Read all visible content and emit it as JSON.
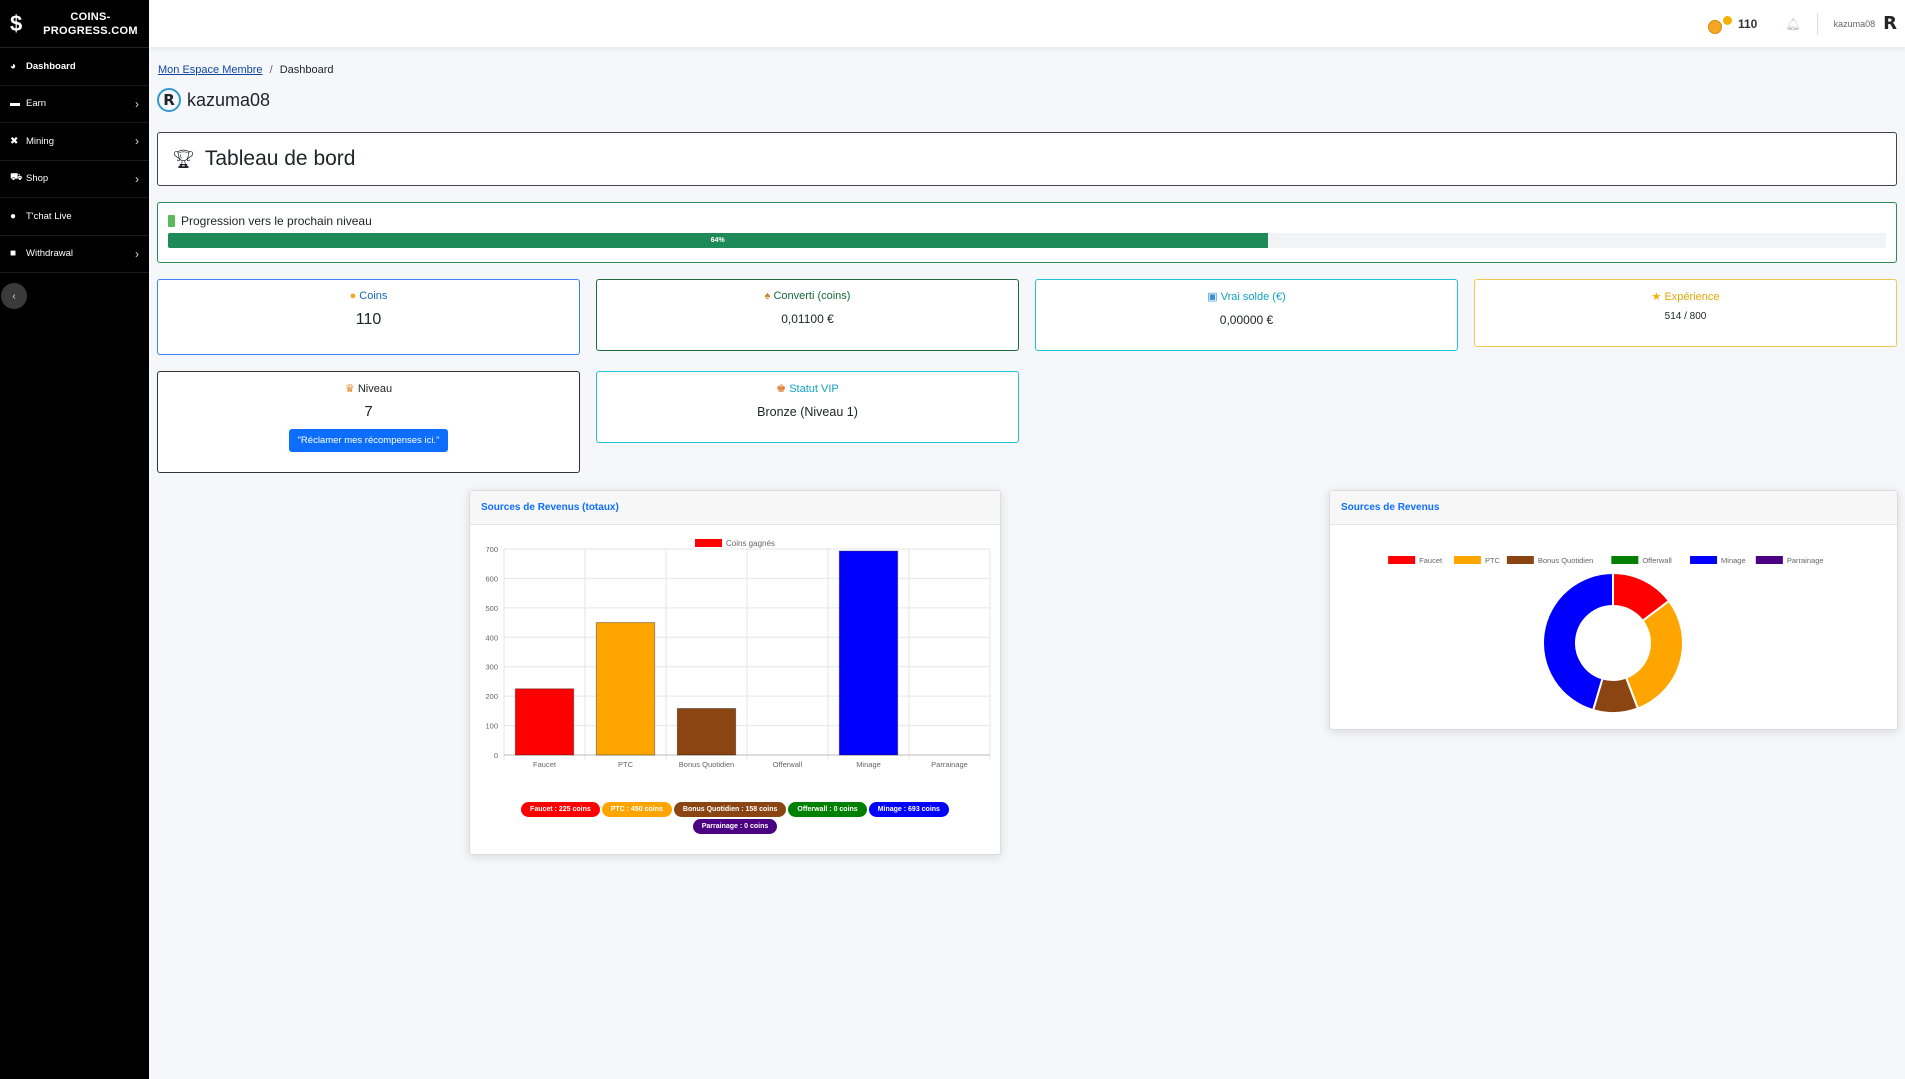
{
  "sidebar": {
    "brand_symbol": "$",
    "brand_line1": "COINS-",
    "brand_line2": "PROGRESS.COM",
    "items": [
      {
        "label": "Dashboard",
        "icon": "dashboard-icon",
        "has_submenu": false
      },
      {
        "label": "Earn",
        "icon": "money-icon",
        "has_submenu": true
      },
      {
        "label": "Mining",
        "icon": "tools-icon",
        "has_submenu": true
      },
      {
        "label": "Shop",
        "icon": "cart-icon",
        "has_submenu": true
      },
      {
        "label": "T'chat Live",
        "icon": "chat-icon",
        "has_submenu": false
      },
      {
        "label": "Withdrawal",
        "icon": "wallet-icon",
        "has_submenu": true
      }
    ]
  },
  "topbar": {
    "coins": "110",
    "username": "kazuma08",
    "logo_letter": "R"
  },
  "breadcrumb": {
    "root": "Mon Espace Membre",
    "separator": "/",
    "current": "Dashboard"
  },
  "profile": {
    "avatar_letter": "R",
    "name": "kazuma08"
  },
  "dashboard": {
    "title": "Tableau de bord"
  },
  "progress": {
    "label": "Progression vers le prochain niveau",
    "percent": 64,
    "percent_label": "64%"
  },
  "stats": {
    "coins": {
      "label": "Coins",
      "value": "110"
    },
    "converted": {
      "label": "Converti (coins)",
      "value": "0,01100 €"
    },
    "balance": {
      "label": "Vrai solde (€)",
      "value": "0,00000 €"
    },
    "experience": {
      "label": "Expérience",
      "value": "514 / 800"
    },
    "level": {
      "label": "Niveau",
      "value": "7",
      "button": "\"Réclamer mes récompenses ici.\""
    },
    "vip": {
      "label": "Statut VIP",
      "value": "Bronze (Niveau 1)"
    }
  },
  "bar_card": {
    "title": "Sources de Revenus (totaux)"
  },
  "donut_card": {
    "title": "Sources de Revenus"
  },
  "pills": [
    {
      "text": "Faucet : 225 coins",
      "color": "#ff0000"
    },
    {
      "text": "PTC : 450 coins",
      "color": "#ffa500"
    },
    {
      "text": "Bonus Quotidien : 158 coins",
      "color": "#8b4513"
    },
    {
      "text": "Offerwall : 0 coins",
      "color": "#008000"
    },
    {
      "text": "Minage : 693 coins",
      "color": "#0000ff"
    },
    {
      "text": "Parrainage : 0 coins",
      "color": "#4b0082"
    }
  ],
  "chart_data": [
    {
      "type": "bar",
      "title": "Sources de Revenus (totaux)",
      "categories": [
        "Faucet",
        "PTC",
        "Bonus Quotidien",
        "Offerwall",
        "Minage",
        "Parrainage"
      ],
      "series": [
        {
          "name": "Coins gagnés",
          "values": [
            225,
            450,
            158,
            0,
            693,
            0
          ]
        }
      ],
      "colors": [
        "#ff0000",
        "#ffa500",
        "#8b4513",
        "#008000",
        "#0000ff",
        "#4b0082"
      ],
      "legend_color": "#ff0000",
      "ylim": [
        0,
        700
      ],
      "yticks": [
        0,
        100,
        200,
        300,
        400,
        500,
        600,
        700
      ],
      "grid": true,
      "legend": "top"
    },
    {
      "type": "pie",
      "title": "Sources de Revenus",
      "labels": [
        "Faucet",
        "PTC",
        "Bonus Quotidien",
        "Offerwall",
        "Minage",
        "Parrainage"
      ],
      "values": [
        225,
        450,
        158,
        0,
        693,
        0
      ],
      "colors": [
        "#ff0000",
        "#ffa500",
        "#8b4513",
        "#008000",
        "#0000ff",
        "#4b0082"
      ],
      "legend": "top"
    }
  ]
}
